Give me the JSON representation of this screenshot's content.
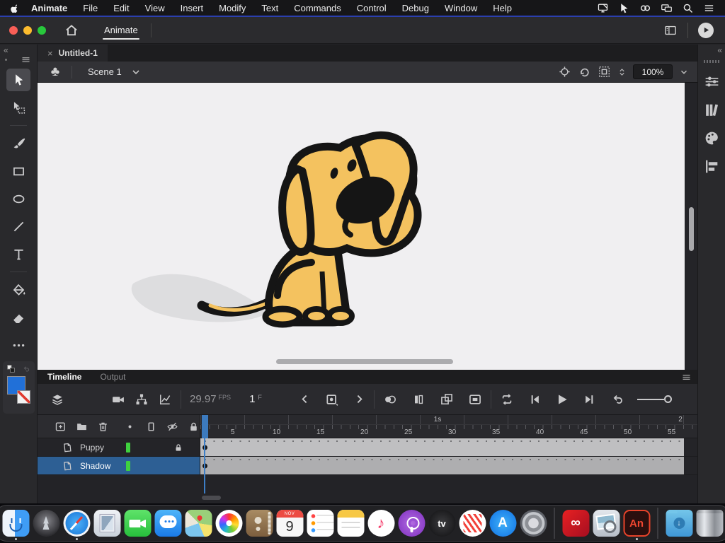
{
  "menu_bar": {
    "items": [
      "Animate",
      "File",
      "Edit",
      "View",
      "Insert",
      "Modify",
      "Text",
      "Commands",
      "Control",
      "Debug",
      "Window",
      "Help"
    ],
    "status_icons": [
      {
        "name": "display-mirroring-icon",
        "icon": "display"
      },
      {
        "name": "screen-pointer-icon",
        "icon": "pointer"
      },
      {
        "name": "creative-cloud-icon",
        "icon": "cc"
      },
      {
        "name": "sidecar-displays-icon",
        "icon": "screens"
      },
      {
        "name": "spotlight-search-icon",
        "icon": "search"
      },
      {
        "name": "notification-center-icon",
        "icon": "list"
      }
    ]
  },
  "title_bar": {
    "workspace_tab": "Animate"
  },
  "document": {
    "tab_title": "Untitled-1",
    "close_glyph": "×"
  },
  "scene_bar": {
    "scene_name": "Scene 1",
    "zoom_level": "100%"
  },
  "toolbar": {
    "tools": [
      {
        "id": "selection-tool",
        "icon": "cursor",
        "active": true
      },
      {
        "id": "free-transform-tool",
        "icon": "transform"
      },
      {
        "divider": true
      },
      {
        "id": "brush-tool",
        "icon": "brush"
      },
      {
        "id": "rectangle-tool",
        "icon": "rect"
      },
      {
        "id": "oval-tool",
        "icon": "oval"
      },
      {
        "id": "line-tool",
        "icon": "line"
      },
      {
        "id": "text-tool",
        "icon": "text"
      },
      {
        "divider": true
      },
      {
        "id": "paint-bucket-tool",
        "icon": "bucket"
      },
      {
        "id": "eraser-tool",
        "icon": "eraser"
      },
      {
        "id": "more-tools",
        "icon": "dots"
      }
    ],
    "fill_color": "#2170d8"
  },
  "timeline": {
    "tabs": [
      "Timeline",
      "Output"
    ],
    "fps_value": "29.97",
    "fps_unit": "FPS",
    "current_frame": "1",
    "frame_unit": "F",
    "ruler_numbers": [
      5,
      10,
      15,
      20,
      25,
      30,
      35,
      40,
      45,
      50,
      55
    ],
    "second_labels": [
      "1s",
      "2"
    ],
    "layers": [
      {
        "name": "Puppy",
        "color": "#3fd13f",
        "locked": true,
        "selected": false
      },
      {
        "name": "Shadow",
        "color": "#3fd13f",
        "locked": false,
        "selected": true
      }
    ]
  },
  "right_panel": {
    "icons": [
      {
        "name": "properties-panel-icon",
        "icon": "sliders"
      },
      {
        "name": "library-panel-icon",
        "icon": "books"
      },
      {
        "name": "color-panel-icon",
        "icon": "palette"
      },
      {
        "name": "align-panel-icon",
        "icon": "align"
      }
    ]
  },
  "dock": {
    "apps": [
      {
        "name": "finder",
        "running": true
      },
      {
        "name": "launchpad",
        "round": true
      },
      {
        "name": "safari",
        "round": true,
        "running": true
      },
      {
        "name": "mail"
      },
      {
        "name": "facetime"
      },
      {
        "name": "messages"
      },
      {
        "name": "maps"
      },
      {
        "name": "photos",
        "round": true
      },
      {
        "name": "contacts"
      },
      {
        "name": "calendar",
        "month": "NOV",
        "day": "9"
      },
      {
        "name": "reminders"
      },
      {
        "name": "notes"
      },
      {
        "name": "music",
        "round": true,
        "label": "♪"
      },
      {
        "name": "podcasts",
        "round": true
      },
      {
        "name": "tv",
        "round": true,
        "label": "tv"
      },
      {
        "name": "news",
        "round": true
      },
      {
        "name": "app-store",
        "round": true,
        "label": "A"
      },
      {
        "name": "system-preferences",
        "round": true
      },
      {
        "divider": true
      },
      {
        "name": "creative-cloud",
        "label": "∞"
      },
      {
        "name": "preview"
      },
      {
        "name": "animate",
        "label": "An",
        "running": true
      },
      {
        "divider": true
      },
      {
        "name": "downloads",
        "arrow": "↓"
      },
      {
        "name": "trash"
      }
    ]
  },
  "colors": {
    "playhead": "#3d7ec6",
    "layer_selected": "#2d5f94",
    "keyframe_green": "#3fd13f",
    "stage_background": "#f0eff1",
    "dog_body": "#f4c25f",
    "dog_outline": "#151515",
    "dog_shadow": "#dddddf"
  }
}
